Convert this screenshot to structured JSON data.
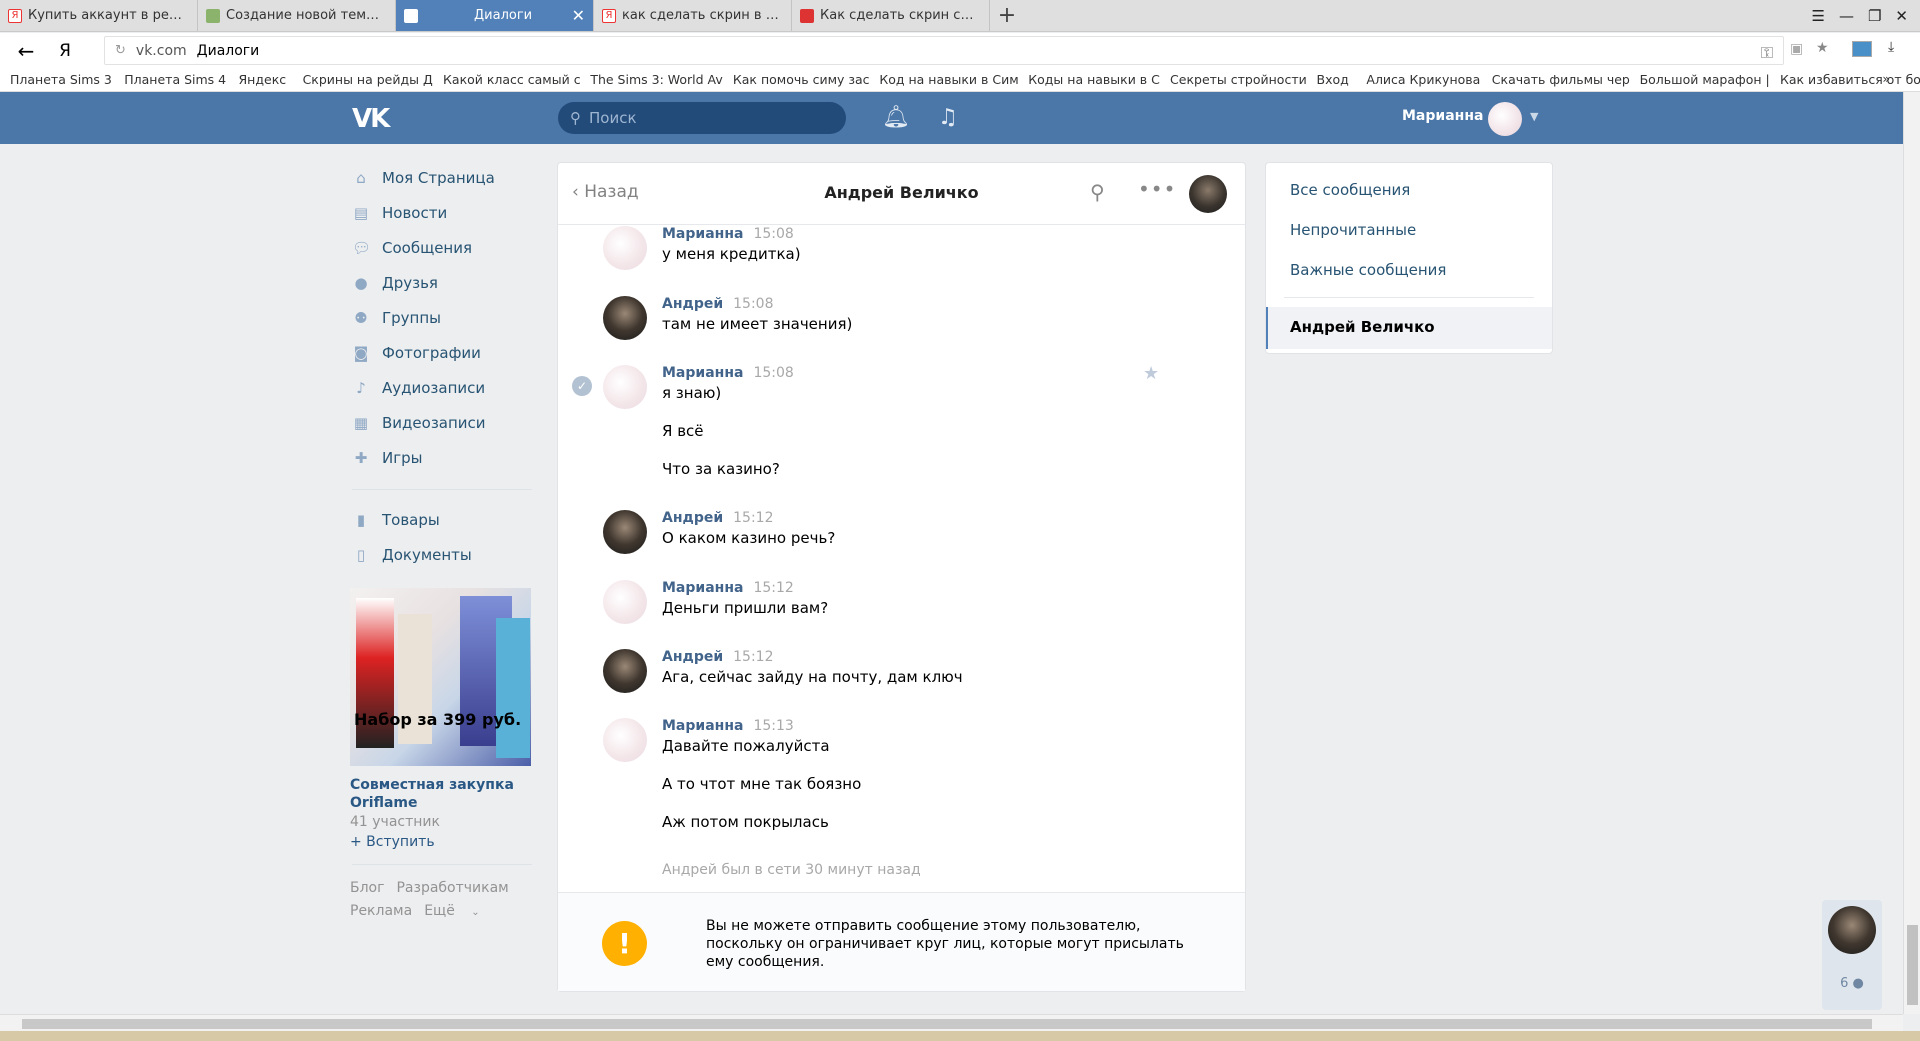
{
  "browser": {
    "tabs": [
      {
        "title": "Купить аккаунт в ревелешн",
        "icon": "yandex-icon"
      },
      {
        "title": "Создание новой темы в ра",
        "icon": "pencil-icon"
      },
      {
        "title": "Диалоги",
        "icon": "vk-message-icon",
        "active": true
      },
      {
        "title": "как сделать скрин в интерн",
        "icon": "yandex-icon"
      },
      {
        "title": "Как сделать скрин страниц",
        "icon": "site-icon"
      }
    ],
    "address_domain": "vk.com",
    "address_title": "Диалоги",
    "yandex_glyph": "Я",
    "bookmarks": [
      "Планета Sims 3",
      "Планета Sims 4",
      "Яндекс",
      "Скрины на рейды Д",
      "Какой класс самый с",
      "The Sims 3: World Av",
      "Как помочь симу зас",
      "Код на навыки в Сим",
      "Коды на навыки в С",
      "Секреты стройности",
      "Вход",
      "Алиса Крикунова",
      "Скачать фильмы чер",
      "Большой марафон |",
      "Как избавиться от бо"
    ]
  },
  "header": {
    "logo": "VK",
    "search_placeholder": "Поиск",
    "user_name": "Марианна"
  },
  "nav": {
    "items": [
      {
        "label": "Моя Страница",
        "icon": "home-icon"
      },
      {
        "label": "Новости",
        "icon": "news-icon"
      },
      {
        "label": "Сообщения",
        "icon": "messages-icon"
      },
      {
        "label": "Друзья",
        "icon": "user-icon"
      },
      {
        "label": "Группы",
        "icon": "groups-icon"
      },
      {
        "label": "Фотографии",
        "icon": "camera-icon"
      },
      {
        "label": "Аудиозаписи",
        "icon": "music-icon"
      },
      {
        "label": "Видеозаписи",
        "icon": "video-icon"
      },
      {
        "label": "Игры",
        "icon": "gamepad-icon"
      }
    ],
    "items2": [
      {
        "label": "Товары",
        "icon": "bag-icon"
      },
      {
        "label": "Документы",
        "icon": "document-icon"
      }
    ]
  },
  "ad": {
    "image_caption": "Набор за 399 руб.",
    "title": "Совместная закупка Oriflame",
    "members": "41 участник",
    "join": "+ Вступить"
  },
  "footer": {
    "blog": "Блог",
    "dev": "Разработчикам",
    "ads": "Реклама",
    "more": "Ещё"
  },
  "dialog": {
    "back": "Назад",
    "title": "Андрей Величко",
    "messages": [
      {
        "author": "Марианна",
        "time": "15:08",
        "lines": [
          "у меня кредитка)"
        ]
      },
      {
        "author": "Андрей",
        "time": "15:08",
        "lines": [
          "там не имеет значения)"
        ]
      },
      {
        "author": "Марианна",
        "time": "15:08",
        "lines": [
          "я знаю)",
          "Я всё",
          "Что за казино?"
        ]
      },
      {
        "author": "Андрей",
        "time": "15:12",
        "lines": [
          "О каком казино речь?"
        ]
      },
      {
        "author": "Марианна",
        "time": "15:12",
        "lines": [
          "Деньги пришли вам?"
        ]
      },
      {
        "author": "Андрей",
        "time": "15:12",
        "lines": [
          "Ага, сейчас зайду на почту, дам ключ"
        ]
      },
      {
        "author": "Марианна",
        "time": "15:13",
        "lines": [
          "Давайте пожалуйста",
          "А то чтот мне так боязно",
          "Аж потом покрылась"
        ]
      }
    ],
    "status": "Андрей был в сети 30 минут назад",
    "warning": "Вы не можете отправить сообщение этому пользователю, поскольку он ограничивает круг лиц, которые могут присылать ему сообщения."
  },
  "right_panel": {
    "all": "Все сообщения",
    "unread": "Непрочитанные",
    "important": "Важные сообщения",
    "selected": "Андрей Величко"
  },
  "mini_chat": {
    "count": "6"
  }
}
